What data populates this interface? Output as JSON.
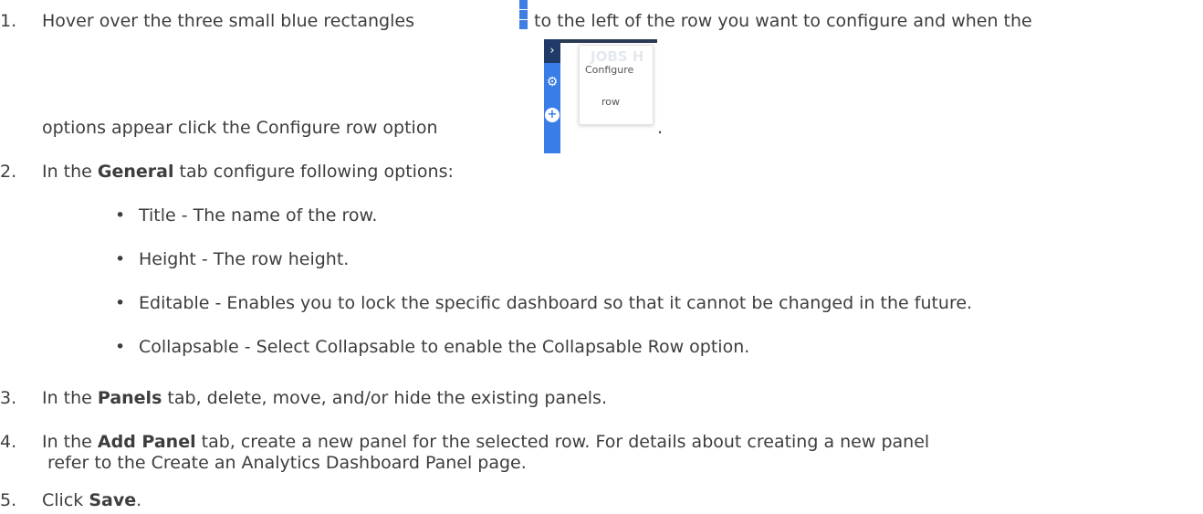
{
  "steps": [
    {
      "number": "1.",
      "line1": "Hover over the three small blue rectangles",
      "line1_after": "to the left of the row you want to configure and when the",
      "line2": "options appear click the Configure row option",
      "line2_after": "."
    },
    {
      "number": "2.",
      "before": "In the ",
      "bold": "General",
      "after": " tab configure following options:",
      "bullets": [
        "Title - The name of the row.",
        "Height - The row height.",
        "Editable - Enables you to lock the specific dashboard so that it cannot be changed in the future.",
        "Collapsable - Select Collapsable to enable the Collapsable Row option."
      ]
    },
    {
      "number": "3.",
      "before": "In the ",
      "bold": "Panels",
      "after": " tab, delete, move, and/or hide the existing panels."
    },
    {
      "number": "4.",
      "before": "In the ",
      "bold": "Add Panel",
      "after": " tab, create a new panel for the selected row. For details about creating a new panel",
      "line2": "refer to the Create an Analytics Dashboard Panel page."
    },
    {
      "number": "5.",
      "before": "Click ",
      "bold": "Save",
      "after": "."
    }
  ],
  "popup": {
    "background_text": "JOBS H",
    "menu_item_1": "Configure",
    "menu_item_2": "row",
    "accent_color": "#3a7de6",
    "dark_color": "#1f3a66"
  },
  "icons": [
    "three-blue-rectangles-icon",
    "chevron-right-icon",
    "gear-icon",
    "plus-circle-icon"
  ]
}
